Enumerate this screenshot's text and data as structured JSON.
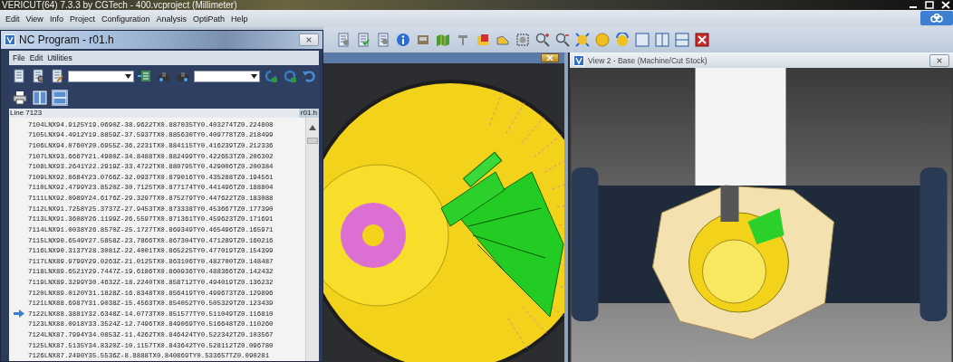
{
  "window": {
    "title": "VERICUT(64)  7.3.3 by CGTech - 400.vcproject (Millimeter)"
  },
  "menu": [
    "Edit",
    "View",
    "Info",
    "Project",
    "Configuration",
    "Analysis",
    "OptiPath",
    "Help"
  ],
  "nc_program": {
    "title": "NC Program - r01.h",
    "menu": [
      "File",
      "Edit",
      "Utilities"
    ],
    "line_label": "Line 7123",
    "file_label": "r01.h",
    "rows": [
      {
        "text": "7104LNX94.9125Y19.0690Z-38.9622TX0.887035TY0.403274TZ0.224808",
        "current": false
      },
      {
        "text": "7105LNX94.4912Y19.8859Z-37.5937TX0.885630TY0.409778TZ0.218499",
        "current": false
      },
      {
        "text": "7106LNX94.0760Y20.6955Z-36.2231TX0.884115TY0.416239TZ0.212336",
        "current": false
      },
      {
        "text": "7107LNX93.6667Y21.4980Z-34.8488TX0.882499TY0.422653TZ0.206302",
        "current": false
      },
      {
        "text": "7108LNX93.2641Y22.2919Z-33.4722TX0.880795TY0.429006TZ0.200384",
        "current": false
      },
      {
        "text": "7109LNX92.8684Y23.0766Z-32.0937TX0.879016TY0.435288TZ0.194561",
        "current": false
      },
      {
        "text": "7110LNX92.4799Y23.8520Z-30.7125TX0.877174TY0.441496TZ0.188804",
        "current": false
      },
      {
        "text": "7111LNX92.0989Y24.6176Z-29.3297TX0.875279TY0.447622TZ0.183088",
        "current": false
      },
      {
        "text": "7112LNX91.7258Y25.3737Z-27.9453TX0.873338TY0.453667TZ0.177390",
        "current": false
      },
      {
        "text": "7113LNX91.3608Y26.1199Z-26.5597TX0.871361TY0.459623TZ0.171691",
        "current": false
      },
      {
        "text": "7114LNX91.0038Y26.8570Z-25.1727TX0.869349TY0.465496TZ0.165971",
        "current": false
      },
      {
        "text": "7115LNX90.6549Y27.5858Z-23.7866TX0.867304TY0.471289TZ0.160216",
        "current": false
      },
      {
        "text": "7116LNX90.3137Y28.3081Z-22.4001TX0.865225TY0.477019TZ0.154399",
        "current": false
      },
      {
        "text": "7117LNX89.9799Y29.0263Z-21.0125TX0.863106TY0.482700TZ0.148487",
        "current": false
      },
      {
        "text": "7118LNX89.6521Y29.7447Z-19.6186TX0.860936TY0.488366TZ0.142432",
        "current": false
      },
      {
        "text": "7119LNX89.3299Y30.4632Z-18.2240TX0.858712TY0.494019TZ0.136232",
        "current": false
      },
      {
        "text": "7120LNX89.0120Y31.1828Z-16.8348TX0.856419TY0.499673TZ0.129896",
        "current": false
      },
      {
        "text": "7121LNX88.6987Y31.9038Z-15.4563TX0.854052TY0.505329TZ0.123439",
        "current": false
      },
      {
        "text": "7122LNX88.3881Y32.6348Z-14.0773TX0.851577TY0.511049TZ0.116810",
        "current": true
      },
      {
        "text": "7123LNX88.0918Y33.3524Z-12.7496TX0.849069TY0.516648TZ0.110260",
        "current": false
      },
      {
        "text": "7124LNX87.7994Y34.0853Z-11.4262TX0.846424TY0.522342TZ0.103567",
        "current": false
      },
      {
        "text": "7125LNX87.5135Y34.8320Z-10.1157TX0.843642TY0.528112TZ0.096780",
        "current": false
      },
      {
        "text": "7126LNX87.2490Y35.5536Z-8.8888TX0.840869TY0.533657TZ0.090281",
        "current": false
      }
    ]
  },
  "view_2": {
    "title": "View 2 - Base (Machine/Cut Stock)"
  }
}
